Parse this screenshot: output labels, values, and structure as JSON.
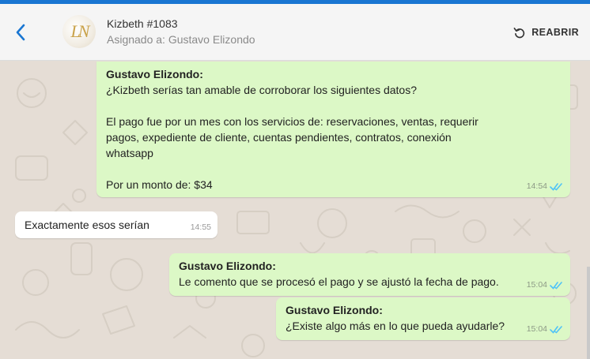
{
  "header": {
    "title": "Kizbeth #1083",
    "subtitle": "Asignado a: Gustavo Elizondo",
    "avatar_initials": "LN",
    "reopen_label": "REABRIR",
    "back_icon": "chevron-left-icon",
    "reopen_icon": "refresh-icon"
  },
  "colors": {
    "accent": "#1976d2",
    "outgoing_bubble": "#dcf8c6",
    "incoming_bubble": "#ffffff",
    "chat_background": "#e5ddd5",
    "read_ticks": "#4fc3f7"
  },
  "messages": [
    {
      "direction": "outgoing",
      "sender": "Gustavo Elizondo:",
      "text": "¿Kizbeth serías tan amable de corroborar los siguientes datos?\n\nEl pago fue por un mes con los servicios de: reservaciones, ventas, requerir\npagos, expediente de cliente, cuentas pendientes, contratos, conexión\nwhatsapp\n\n Por un monto de: $34",
      "time": "14:54",
      "status": "read"
    },
    {
      "direction": "incoming",
      "sender": "",
      "text": "Exactamente esos serían",
      "time": "14:55",
      "status": ""
    },
    {
      "direction": "outgoing",
      "sender": "Gustavo Elizondo:",
      "text": "Le comento que se procesó el pago y se ajustó la fecha de pago.",
      "time": "15:04",
      "status": "read"
    },
    {
      "direction": "outgoing",
      "sender": "Gustavo Elizondo:",
      "text": "¿Existe algo más en lo que pueda ayudarle?",
      "time": "15:04",
      "status": "read"
    }
  ]
}
